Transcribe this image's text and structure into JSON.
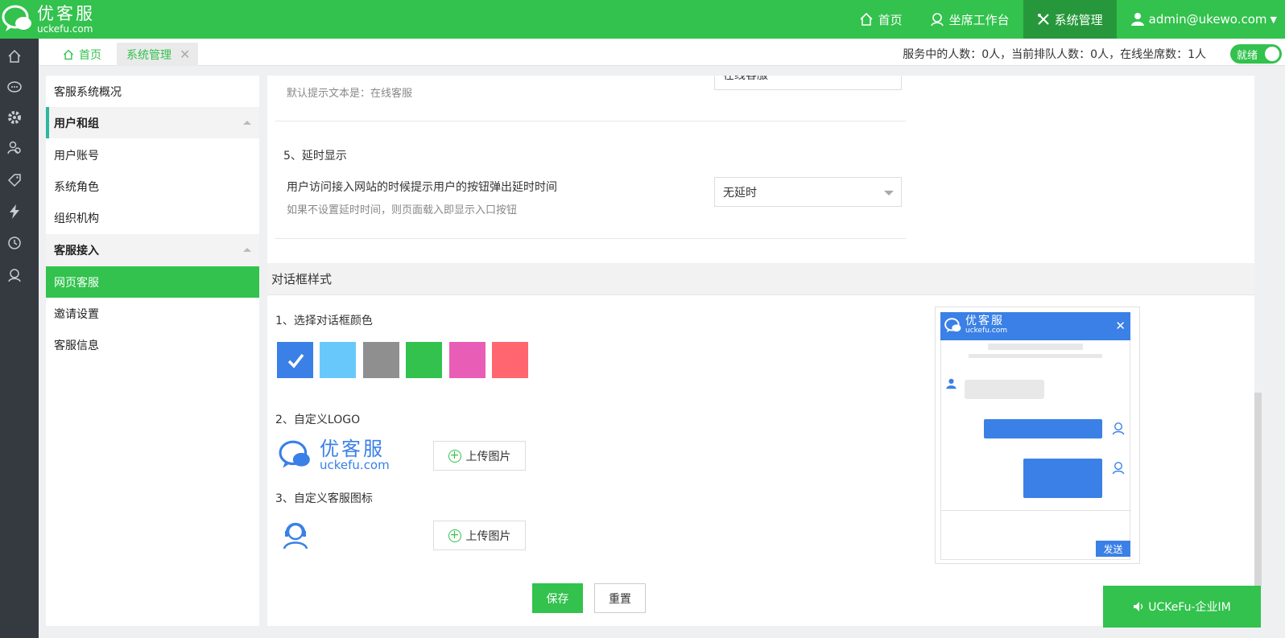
{
  "app": {
    "name": "优客服",
    "domain": "uckefu.com"
  },
  "topnav": {
    "home": "首页",
    "workbench": "坐席工作台",
    "system": "系统管理",
    "user": "admin@ukewo.com"
  },
  "tabs": {
    "home": "首页",
    "system": "系统管理",
    "close": "✕"
  },
  "status": {
    "text": "服务中的人数：0人，当前排队人数：0人，在线坐席数：1人",
    "ready": "就绪"
  },
  "sidebar": {
    "items": [
      {
        "label": "客服系统概况"
      },
      {
        "label": "用户和组"
      },
      {
        "label": "用户账号"
      },
      {
        "label": "系统角色"
      },
      {
        "label": "组织机构"
      },
      {
        "label": "客服接入"
      },
      {
        "label": "网页客服"
      },
      {
        "label": "邀请设置"
      },
      {
        "label": "客服信息"
      }
    ]
  },
  "form": {
    "prompt_value": "在线客服",
    "prompt_hint": "默认提示文本是：在线客服",
    "delay_title": "5、延时显示",
    "delay_desc": "用户访问接入网站的时候提示用户的按钮弹出延时时间",
    "delay_hint": "如果不设置延时时间，则页面载入即显示入口按钮",
    "delay_value": "无延时"
  },
  "dialog_style": {
    "section_title": "对话框样式",
    "color_label": "1、选择对话框颜色",
    "colors": [
      "#3a80e6",
      "#69c8fb",
      "#8f8f8f",
      "#32c24d",
      "#e85db5",
      "#ff6670"
    ],
    "selected_color": "#3a80e6",
    "logo_label": "2、自定义LOGO",
    "logo_name": "优客服",
    "logo_domain": "uckefu.com",
    "agent_icon_label": "3、自定义客服图标",
    "upload_label": "上传图片",
    "save": "保存",
    "reset": "重置"
  },
  "preview": {
    "brand": "优客服",
    "domain": "uckefu.com",
    "close": "✕",
    "send": "发送"
  },
  "im_float": "UCKeFu-企业IM"
}
